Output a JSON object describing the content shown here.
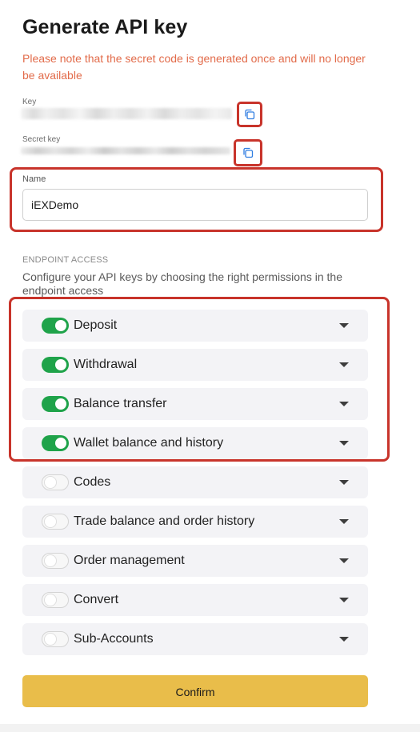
{
  "header": {
    "title": "Generate API key",
    "warning": "Please note that the secret code is generated once and will no longer be available"
  },
  "key": {
    "label": "Key",
    "copy_icon": "copy-icon"
  },
  "secret_key": {
    "label": "Secret key",
    "copy_icon": "copy-icon"
  },
  "name": {
    "label": "Name",
    "value": "iEXDemo"
  },
  "endpoint_access": {
    "title": "ENDPOINT ACCESS",
    "description": "Configure your API keys by choosing the right permissions in the endpoint access",
    "items": [
      {
        "label": "Deposit",
        "enabled": true
      },
      {
        "label": "Withdrawal",
        "enabled": true
      },
      {
        "label": "Balance transfer",
        "enabled": true
      },
      {
        "label": "Wallet balance and history",
        "enabled": true
      },
      {
        "label": "Codes",
        "enabled": false
      },
      {
        "label": "Trade balance and order history",
        "enabled": false
      },
      {
        "label": "Order management",
        "enabled": false
      },
      {
        "label": "Convert",
        "enabled": false
      },
      {
        "label": "Sub-Accounts",
        "enabled": false
      }
    ]
  },
  "confirm_label": "Confirm",
  "colors": {
    "warning": "#e26b4a",
    "toggle_on": "#1fa34a",
    "confirm": "#e9bd4a",
    "highlight": "#c8342b"
  }
}
